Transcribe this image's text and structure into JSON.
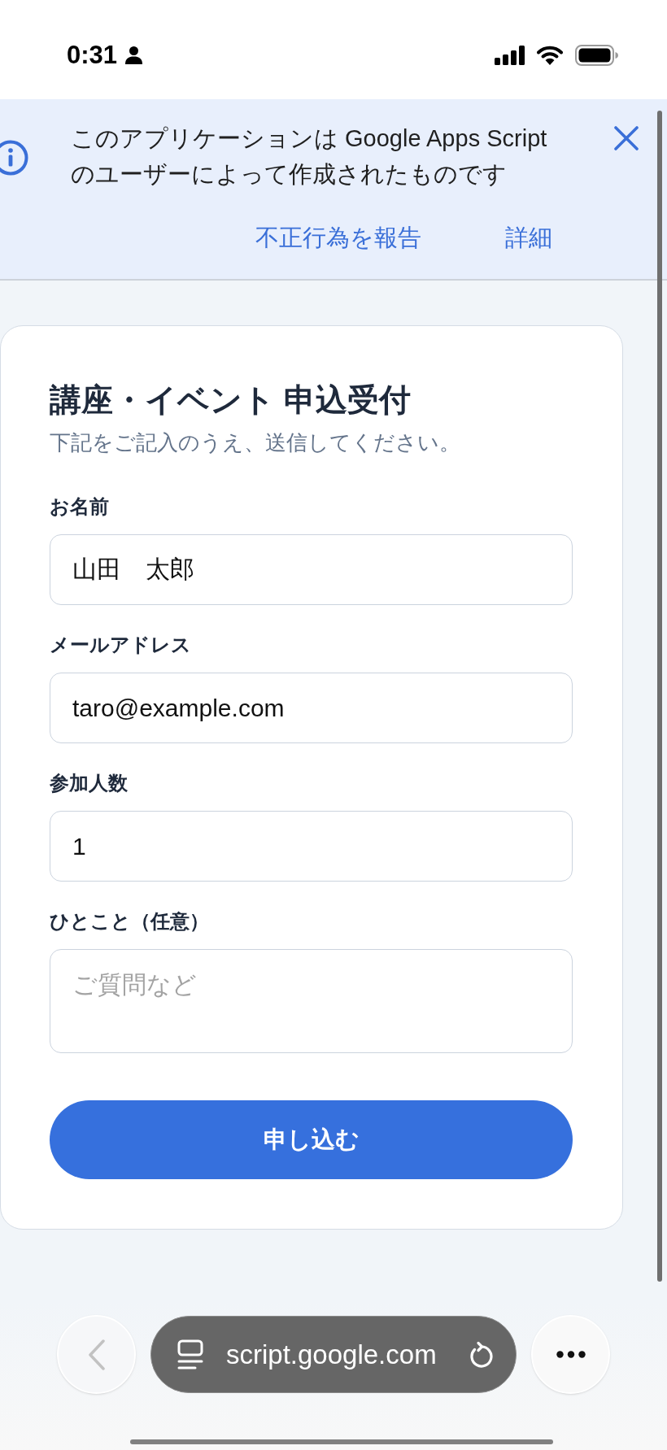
{
  "status_bar": {
    "time": "0:31"
  },
  "banner": {
    "message": "このアプリケーションは Google Apps Script のユーザーによって作成されたものです",
    "links": [
      "不正行為を報告",
      "詳細"
    ]
  },
  "form": {
    "title": "講座・イベント 申込受付",
    "subtitle": "下記をご記入のうえ、送信してください。",
    "fields": [
      {
        "label": "お名前",
        "kind": "input",
        "value": "山田　太郎"
      },
      {
        "label": "メールアドレス",
        "kind": "input",
        "value": "taro@example.com"
      },
      {
        "label": "参加人数",
        "kind": "input",
        "value": "1"
      },
      {
        "label": "ひとこと（任意）",
        "kind": "textarea",
        "placeholder": "ご質問など"
      }
    ],
    "submit": "申し込む"
  },
  "browser_bar": {
    "back": {
      "disabled": true
    },
    "url": "script.google.com"
  }
}
